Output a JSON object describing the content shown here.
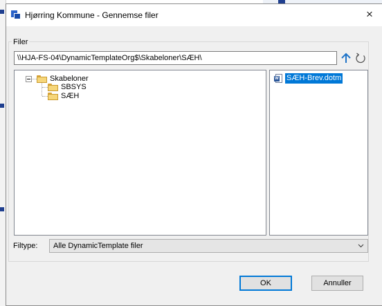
{
  "dialog": {
    "title": "Hjørring Kommune - Gennemse filer",
    "close_glyph": "×"
  },
  "files_group": {
    "label": "Filer",
    "path_value": "\\\\HJA-FS-04\\DynamicTemplateOrg$\\Skabeloner\\SÆH\\",
    "up_icon": "arrow-up-icon",
    "refresh_icon": "refresh-icon"
  },
  "tree": {
    "root": {
      "label": "Skabeloner",
      "expanded": true
    },
    "children": [
      {
        "label": "SBSYS"
      },
      {
        "label": "SÆH"
      }
    ]
  },
  "file_list": {
    "items": [
      {
        "label": "SÆH-Brev.dotm",
        "selected": true,
        "icon": "word-document-icon"
      }
    ]
  },
  "filetype": {
    "label": "Filtype:",
    "selected": "Alle DynamicTemplate filer"
  },
  "buttons": {
    "ok": "OK",
    "cancel": "Annuller"
  },
  "colors": {
    "accent": "#0078d7",
    "selection": "#0078d7",
    "folder": "#f6d67a"
  }
}
